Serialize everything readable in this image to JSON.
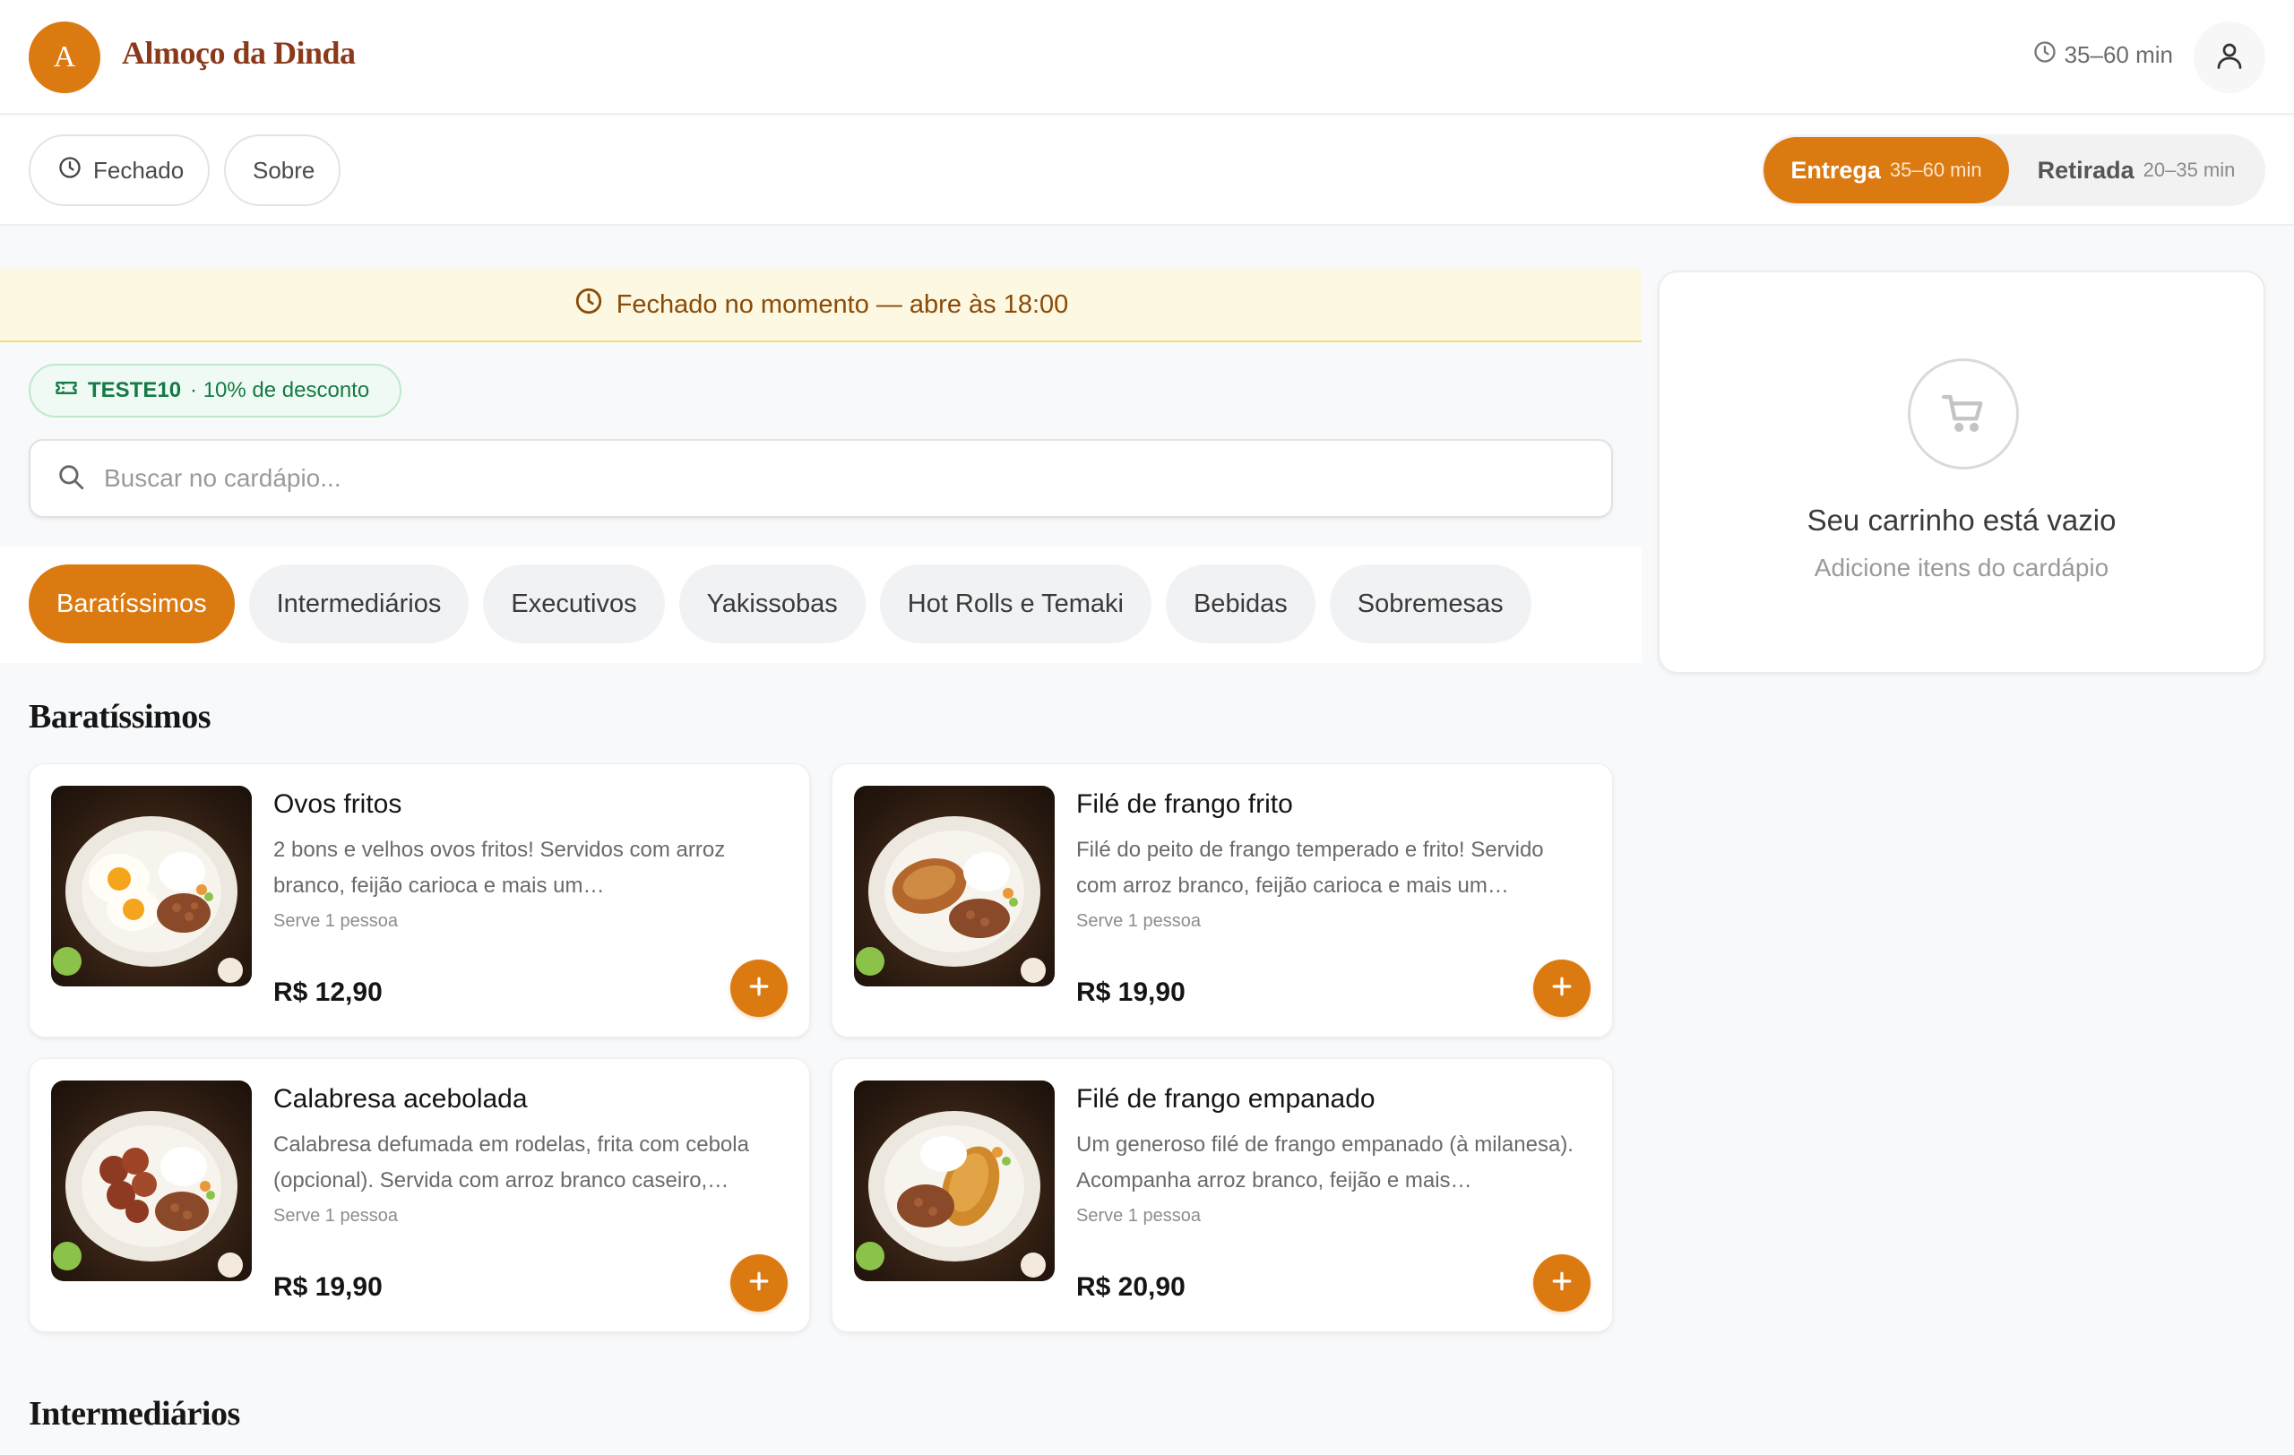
{
  "header": {
    "logo_letter": "A",
    "brand_name": "Almoço da Dinda",
    "eta": "35–60 min"
  },
  "subbar": {
    "status_label": "Fechado",
    "about_label": "Sobre",
    "delivery_label": "Entrega",
    "delivery_eta": "35–60 min",
    "pickup_label": "Retirada",
    "pickup_eta": "20–35 min"
  },
  "banner": {
    "text": "Fechado no momento — abre às 18:00"
  },
  "coupon": {
    "code": "TESTE10",
    "text": "· 10% de desconto"
  },
  "search": {
    "placeholder": "Buscar no cardápio..."
  },
  "categories": [
    "Baratíssimos",
    "Intermediários",
    "Executivos",
    "Yakissobas",
    "Hot Rolls e Temaki",
    "Bebidas",
    "Sobremesas"
  ],
  "sections": [
    {
      "title": "Baratíssimos",
      "items": [
        {
          "name": "Ovos fritos",
          "description": "2 bons e velhos ovos fritos! Servidos com arroz branco, feijão carioca e mais um…",
          "serves": "Serve 1 pessoa",
          "price": "R$ 12,90"
        },
        {
          "name": "Filé de frango frito",
          "description": "Filé do peito de frango temperado e frito! Servido com arroz branco, feijão carioca e mais um…",
          "serves": "Serve 1 pessoa",
          "price": "R$ 19,90"
        },
        {
          "name": "Calabresa acebolada",
          "description": "Calabresa defumada em rodelas, frita com cebola (opcional). Servida com arroz branco caseiro,…",
          "serves": "Serve 1 pessoa",
          "price": "R$ 19,90"
        },
        {
          "name": "Filé de frango empanado",
          "description": "Um generoso filé de frango empanado (à milanesa). Acompanha arroz branco, feijão e mais…",
          "serves": "Serve 1 pessoa",
          "price": "R$ 20,90"
        }
      ]
    },
    {
      "title": "Intermediários"
    }
  ],
  "cart": {
    "title": "Seu carrinho está vazio",
    "subtitle": "Adicione itens do cardápio"
  },
  "colors": {
    "accent": "#dc7a12",
    "brand_text": "#8a3a1a",
    "banner_bg": "#fdf8e1",
    "coupon_green": "#167a46"
  },
  "icons": {
    "eta": "clock-icon",
    "user": "user-icon",
    "status": "clock-icon",
    "banner": "clock-icon",
    "coupon": "ticket-icon",
    "search": "search-icon",
    "add": "plus-icon",
    "cart": "cart-icon"
  }
}
